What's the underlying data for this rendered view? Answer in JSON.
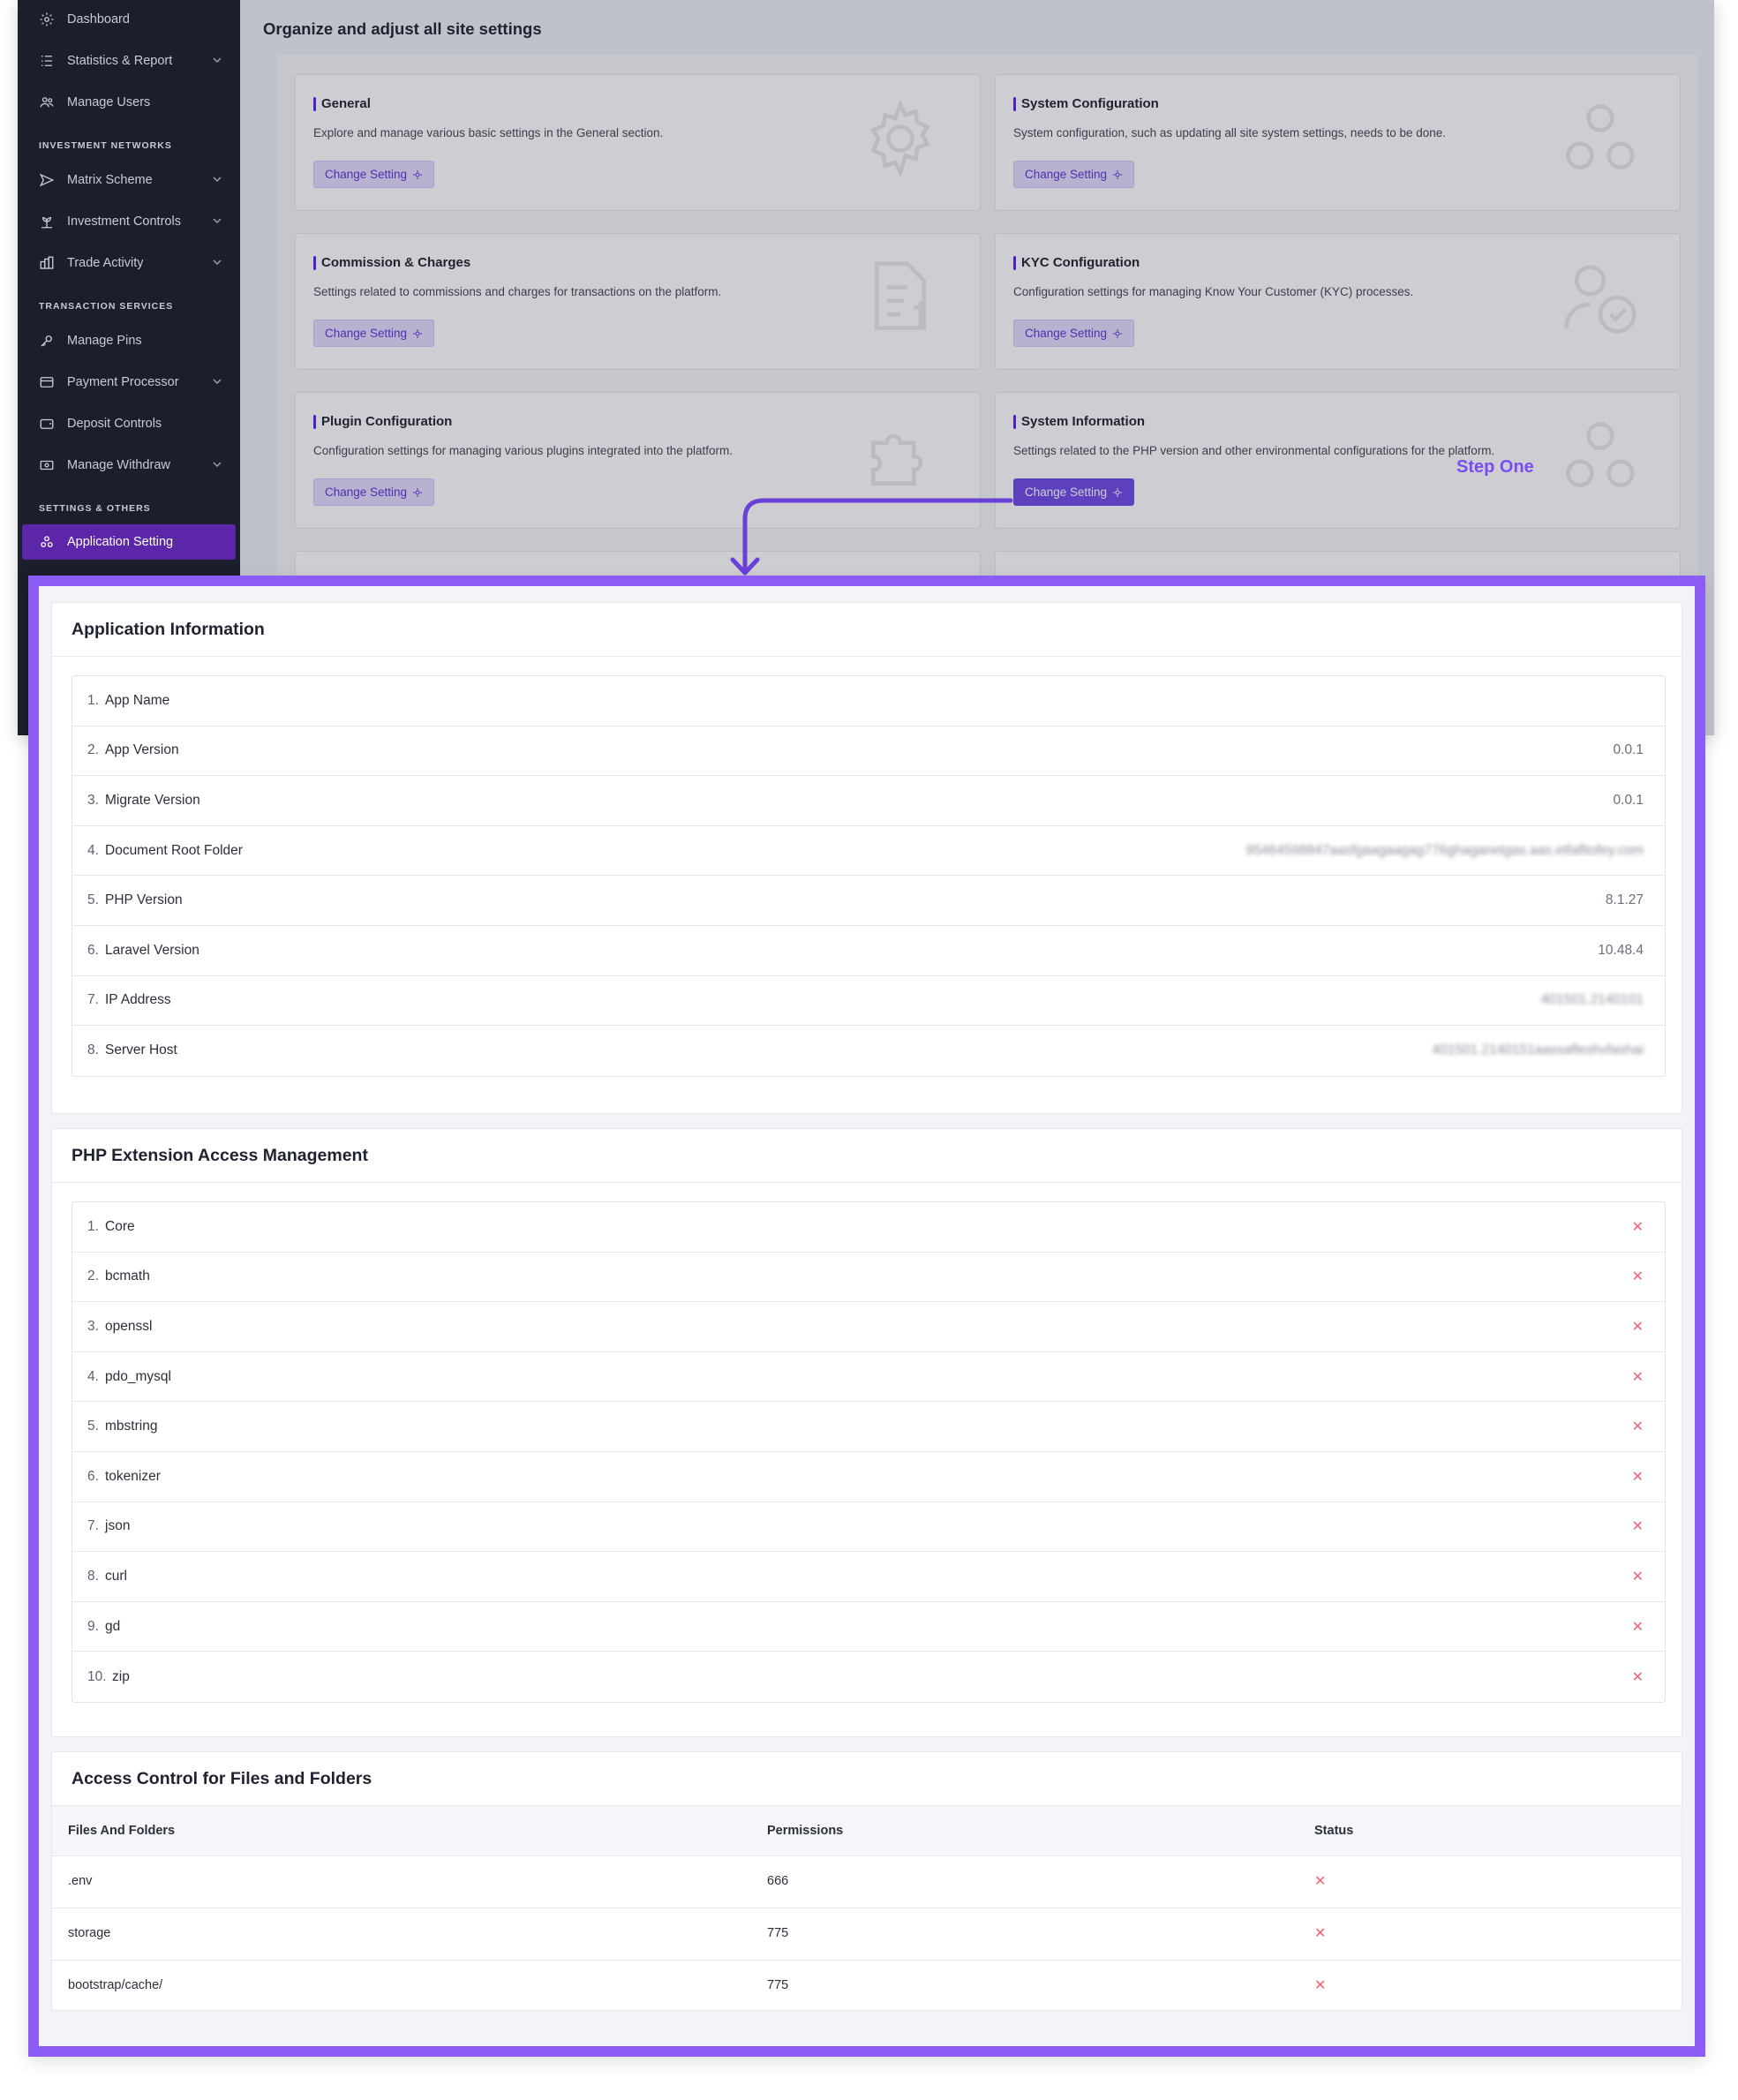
{
  "sidebar": {
    "items": [
      {
        "label": "Dashboard",
        "icon": "gear-icon",
        "has_chevron": false
      },
      {
        "label": "Statistics & Report",
        "icon": "list-icon",
        "has_chevron": true
      },
      {
        "label": "Manage Users",
        "icon": "users-icon",
        "has_chevron": false
      },
      {
        "label": "Matrix Scheme",
        "icon": "send-icon",
        "has_chevron": true
      },
      {
        "label": "Investment Controls",
        "icon": "plant-icon",
        "has_chevron": true
      },
      {
        "label": "Trade Activity",
        "icon": "stack-icon",
        "has_chevron": true
      },
      {
        "label": "Manage Pins",
        "icon": "key-icon",
        "has_chevron": false
      },
      {
        "label": "Payment Processor",
        "icon": "card-icon",
        "has_chevron": true
      },
      {
        "label": "Deposit Controls",
        "icon": "wallet-icon",
        "has_chevron": false
      },
      {
        "label": "Manage Withdraw",
        "icon": "cash-icon",
        "has_chevron": true
      },
      {
        "label": "Application Setting",
        "icon": "apps-icon",
        "has_chevron": false
      }
    ],
    "sections": [
      "INVESTMENT NETWORKS",
      "TRANSACTION SERVICES",
      "SETTINGS & OTHERS"
    ]
  },
  "content": {
    "title": "Organize and adjust all site settings",
    "cards": [
      {
        "title": "General",
        "description": "Explore and manage various basic settings in the General section.",
        "button": "Change Setting",
        "icon": "gear-icon"
      },
      {
        "title": "System Configuration",
        "description": "System configuration, such as updating all site system settings, needs to be done.",
        "button": "Change Setting",
        "icon": "network-icon"
      },
      {
        "title": "Commission & Charges",
        "description": "Settings related to commissions and charges for transactions on the platform.",
        "button": "Change Setting",
        "icon": "invoice-icon"
      },
      {
        "title": "KYC Configuration",
        "description": "Configuration settings for managing Know Your Customer (KYC) processes.",
        "button": "Change Setting",
        "icon": "user-check-icon"
      },
      {
        "title": "Plugin Configuration",
        "description": "Configuration settings for managing various plugins integrated into the platform.",
        "button": "Change Setting",
        "icon": "puzzle-icon"
      },
      {
        "title": "System Information",
        "description": "Settings related to the PHP version and other environmental configurations for the platform.",
        "button": "Change Setting",
        "icon": "network-icon"
      }
    ],
    "step_label": "Step One"
  },
  "app_info": {
    "title": "Application Information",
    "rows": [
      {
        "num": "1.",
        "label": "App Name",
        "value": ""
      },
      {
        "num": "2.",
        "label": "App Version",
        "value": "0.0.1"
      },
      {
        "num": "3.",
        "label": "Migrate Version",
        "value": "0.0.1"
      },
      {
        "num": "4.",
        "label": "Document Root Folder",
        "value": "95464598847aasfgaagaagag776ghaganetgas.aas.etfafltofey.com"
      },
      {
        "num": "5.",
        "label": "PHP Version",
        "value": "8.1.27"
      },
      {
        "num": "6.",
        "label": "Laravel Version",
        "value": "10.48.4"
      },
      {
        "num": "7.",
        "label": "IP Address",
        "value": "401501.2140101"
      },
      {
        "num": "8.",
        "label": "Server Host",
        "value": "401501.2140151aassafleshvfashai"
      }
    ]
  },
  "php_ext": {
    "title": "PHP Extension Access Management",
    "rows": [
      {
        "num": "1.",
        "label": "Core",
        "status": "✕"
      },
      {
        "num": "2.",
        "label": "bcmath",
        "status": "✕"
      },
      {
        "num": "3.",
        "label": "openssl",
        "status": "✕"
      },
      {
        "num": "4.",
        "label": "pdo_mysql",
        "status": "✕"
      },
      {
        "num": "5.",
        "label": "mbstring",
        "status": "✕"
      },
      {
        "num": "6.",
        "label": "tokenizer",
        "status": "✕"
      },
      {
        "num": "7.",
        "label": "json",
        "status": "✕"
      },
      {
        "num": "8.",
        "label": "curl",
        "status": "✕"
      },
      {
        "num": "9.",
        "label": "gd",
        "status": "✕"
      },
      {
        "num": "10.",
        "label": "zip",
        "status": "✕"
      }
    ]
  },
  "files": {
    "title": "Access Control for Files and Folders",
    "columns": [
      "Files And Folders",
      "Permissions",
      "Status"
    ],
    "rows": [
      {
        "name": ".env",
        "perm": "666",
        "status": "✕"
      },
      {
        "name": "storage",
        "perm": "775",
        "status": "✕"
      },
      {
        "name": "bootstrap/cache/",
        "perm": "775",
        "status": "✕"
      }
    ]
  },
  "colors": {
    "sidebar_bg": "#1b1f2c",
    "active_item": "#5b27a8",
    "frame_border": "#8b5cf6",
    "accent": "#6f49e6",
    "error_x": "#f06272"
  }
}
